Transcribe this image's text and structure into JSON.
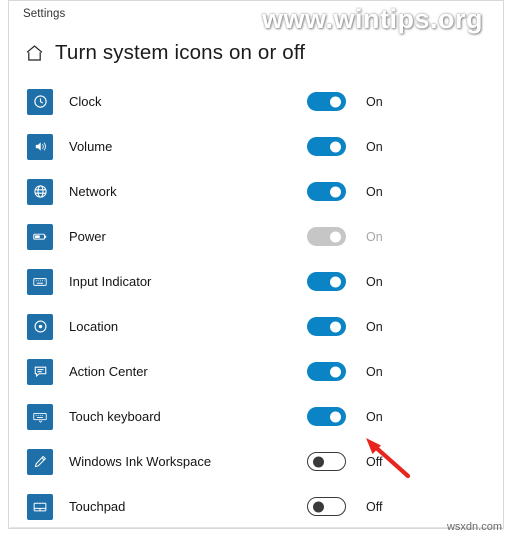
{
  "window": {
    "titlebar_label": "Settings",
    "page_title": "Turn system icons on or off",
    "home_icon": "home-icon"
  },
  "watermark": {
    "text": "www.wintips.org",
    "corner_text": "wsxdn.com"
  },
  "rows": [
    {
      "label": "Clock",
      "icon": "clock-icon",
      "state": "On",
      "toggle": "on"
    },
    {
      "label": "Volume",
      "icon": "volume-icon",
      "state": "On",
      "toggle": "on"
    },
    {
      "label": "Network",
      "icon": "network-globe-icon",
      "state": "On",
      "toggle": "on"
    },
    {
      "label": "Power",
      "icon": "battery-icon",
      "state": "On",
      "toggle": "disabled"
    },
    {
      "label": "Input Indicator",
      "icon": "keyboard-icon",
      "state": "On",
      "toggle": "on"
    },
    {
      "label": "Location",
      "icon": "location-icon",
      "state": "On",
      "toggle": "on"
    },
    {
      "label": "Action Center",
      "icon": "action-center-icon",
      "state": "On",
      "toggle": "on"
    },
    {
      "label": "Touch keyboard",
      "icon": "touch-keyboard-icon",
      "state": "On",
      "toggle": "on"
    },
    {
      "label": "Windows Ink Workspace",
      "icon": "pen-icon",
      "state": "Off",
      "toggle": "off"
    },
    {
      "label": "Touchpad",
      "icon": "touchpad-icon",
      "state": "Off",
      "toggle": "off"
    }
  ],
  "colors": {
    "accent": "#0a84c4",
    "icon_tile": "#1f6fa8",
    "arrow": "#e8251c"
  }
}
